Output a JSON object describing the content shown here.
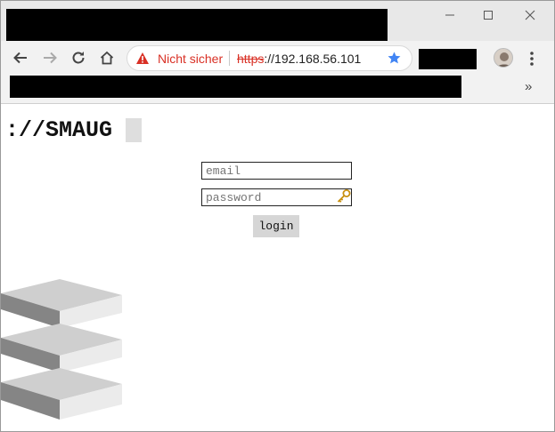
{
  "window": {
    "controls": {
      "minimize": "minimize-icon",
      "maximize": "maximize-icon",
      "close": "close-icon"
    }
  },
  "toolbar": {
    "security_label": "Nicht sicher",
    "url_scheme": "https",
    "url_rest": "://192.168.56.101",
    "extensions_chevron": "»"
  },
  "page": {
    "brand": "://SMAUG",
    "email_placeholder": "email",
    "password_placeholder": "password",
    "login_label": "login"
  },
  "colors": {
    "warning_red": "#d93025",
    "star_blue": "#4285f4",
    "key_gold": "#d4a017"
  }
}
